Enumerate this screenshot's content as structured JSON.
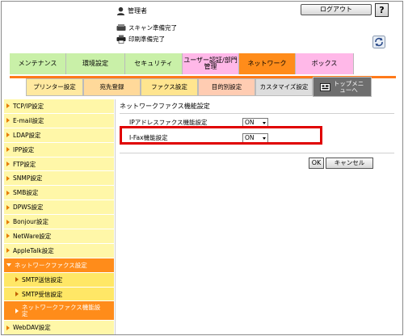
{
  "header": {
    "user": "管理者",
    "logout_label": "ログアウト",
    "help_label": "?",
    "status_scan": "スキャン準備完了",
    "status_print": "印刷準備完了"
  },
  "tabs": [
    {
      "label": "メンテナンス",
      "color": "#c9f0a8"
    },
    {
      "label": "環境設定",
      "color": "#c9f0a8"
    },
    {
      "label": "セキュリティ",
      "color": "#c9f0a8"
    },
    {
      "label": "ユーザー認証/部門管理",
      "color": "#ffb8e8"
    },
    {
      "label": "ネットワーク",
      "color": "#ff8c1a",
      "active": true
    },
    {
      "label": "ボックス",
      "color": "#ffb8e8"
    }
  ],
  "sub_tabs": [
    {
      "label": "プリンター設定",
      "color": "#ffe9a0"
    },
    {
      "label": "宛先登録",
      "color": "#ffd99a"
    },
    {
      "label": "ファクス設定",
      "color": "#ffe58f"
    },
    {
      "label": "目的別設定",
      "color": "#ffccb2"
    },
    {
      "label": "カスタマイズ設定",
      "color": "#dddddd"
    },
    {
      "label": "トップメニューへ",
      "color": "#6e6e6e"
    }
  ],
  "sidebar": {
    "items": [
      {
        "label": "TCP/IP設定"
      },
      {
        "label": "E-mail設定"
      },
      {
        "label": "LDAP設定"
      },
      {
        "label": "IPP設定"
      },
      {
        "label": "FTP設定"
      },
      {
        "label": "SNMP設定"
      },
      {
        "label": "SMB設定"
      },
      {
        "label": "DPWS設定"
      },
      {
        "label": "Bonjour設定"
      },
      {
        "label": "NetWare設定"
      },
      {
        "label": "AppleTalk設定"
      },
      {
        "label": "ネットワークファクス設定",
        "open": true
      },
      {
        "label": "SMTP送信設定",
        "sub": true
      },
      {
        "label": "SMTP受信設定",
        "sub": true
      },
      {
        "label": "ネットワークファクス機能設定",
        "sub_active": true
      },
      {
        "label": "WebDAV設定"
      }
    ]
  },
  "main": {
    "title": "ネットワークファクス機能設定",
    "rows": [
      {
        "label": "IPアドレスファクス機能設定",
        "value": "ON"
      },
      {
        "label": "I-Fax機能設定",
        "value": "ON"
      }
    ],
    "ok_label": "OK",
    "cancel_label": "キャンセル"
  },
  "colors": {
    "accent": "#ff8c1a",
    "highlight": "#e00000"
  }
}
